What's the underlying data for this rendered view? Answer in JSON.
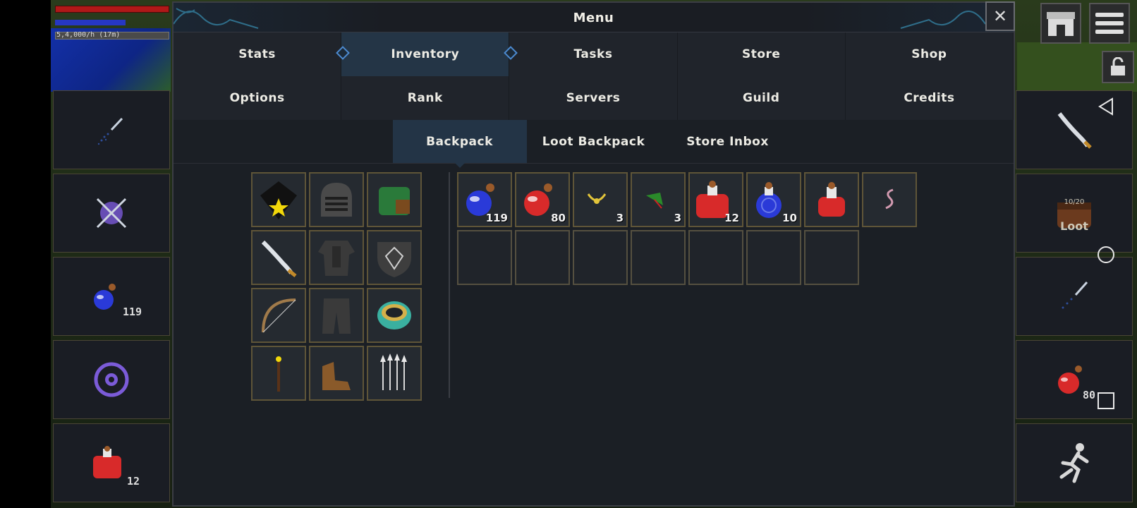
{
  "hud": {
    "xp_text": "5,4,000/h (17m)"
  },
  "menu": {
    "title": "Menu",
    "close_label": "✕",
    "tabs_row1": [
      "Stats",
      "Inventory",
      "Tasks",
      "Store",
      "Shop"
    ],
    "tabs_row2": [
      "Options",
      "Rank",
      "Servers",
      "Guild",
      "Credits"
    ],
    "active_tab": "Inventory",
    "subtabs": [
      "Backpack",
      "Loot Backpack",
      "Store Inbox"
    ],
    "active_subtab": "Backpack"
  },
  "equipment": [
    "hood-icon",
    "helmet-icon",
    "backpack-icon",
    "scimitar-icon",
    "platebody-icon",
    "shield-icon",
    "bow-icon",
    "platelegs-icon",
    "ring-icon",
    "wand-icon",
    "boots-icon",
    "arrows-icon"
  ],
  "backpack": [
    {
      "icon": "blue-potion-icon",
      "qty": "119"
    },
    {
      "icon": "red-potion-icon",
      "qty": "80"
    },
    {
      "icon": "amulet-icon",
      "qty": "3"
    },
    {
      "icon": "leaf-icon",
      "qty": "3"
    },
    {
      "icon": "large-red-potion-icon",
      "qty": "12"
    },
    {
      "icon": "swirl-potion-icon",
      "qty": "10"
    },
    {
      "icon": "red-flask-icon",
      "qty": ""
    },
    {
      "icon": "worm-icon",
      "qty": ""
    }
  ],
  "left_bar": {
    "slot3_count": "119",
    "slot5_count": "12"
  },
  "right_bar": {
    "loot_capacity": "10/20",
    "loot_label": "Loot",
    "slot5_count": "80"
  },
  "colors": {
    "accent": "#4c8ad0",
    "slot_border": "#5f5538",
    "panel": "#1b1f25"
  }
}
